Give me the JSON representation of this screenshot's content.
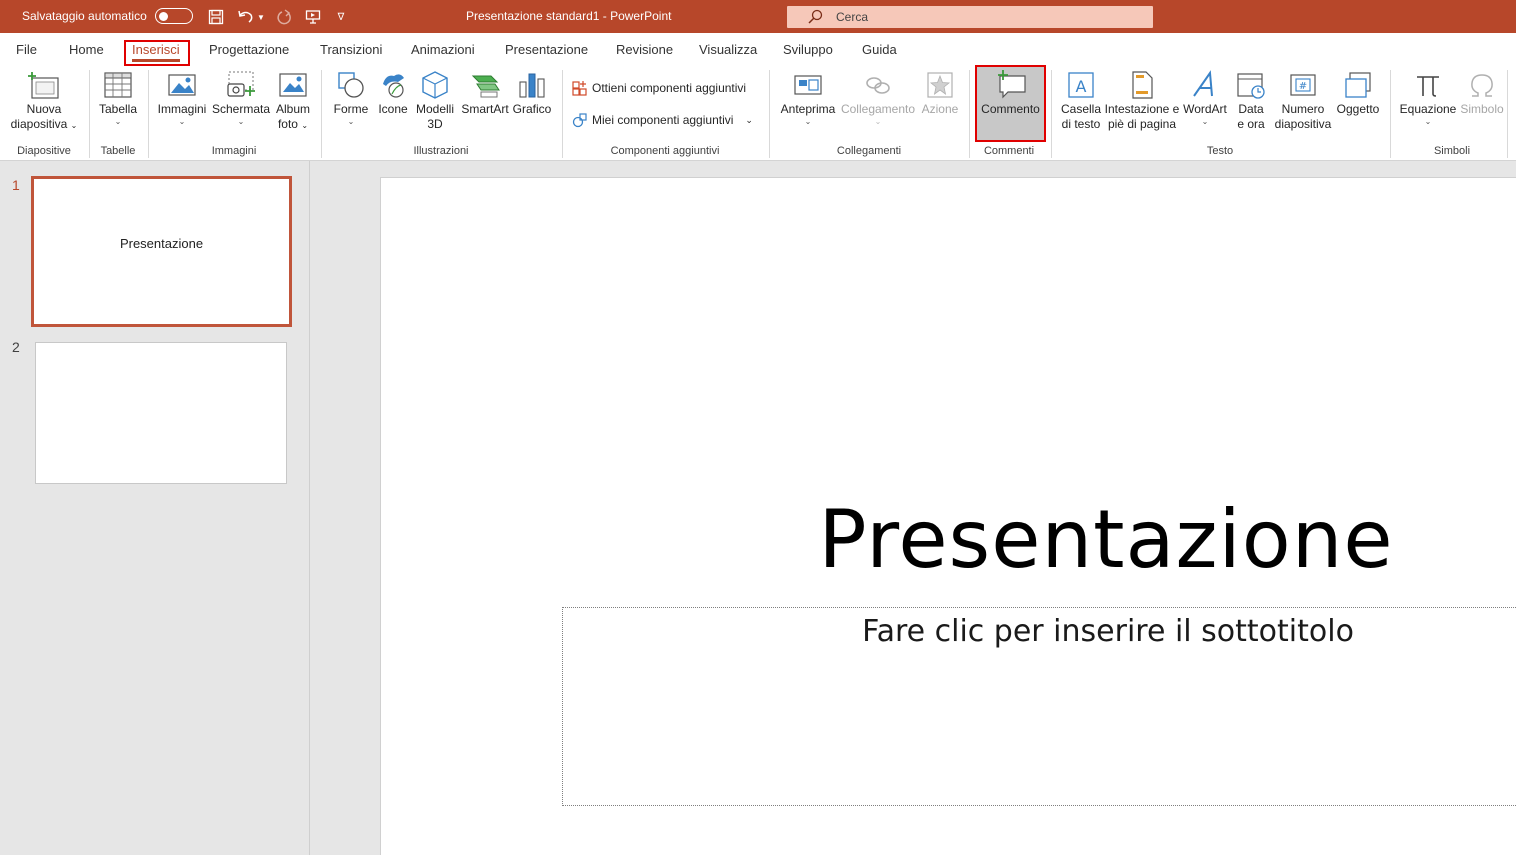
{
  "titlebar": {
    "autosave_label": "Salvataggio automatico",
    "doc_title": "Presentazione standard1  -  PowerPoint",
    "search_placeholder": "Cerca"
  },
  "tabs": [
    {
      "label": "File"
    },
    {
      "label": "Home"
    },
    {
      "label": "Inserisci",
      "active": true
    },
    {
      "label": "Progettazione"
    },
    {
      "label": "Transizioni"
    },
    {
      "label": "Animazioni"
    },
    {
      "label": "Presentazione"
    },
    {
      "label": "Revisione"
    },
    {
      "label": "Visualizza"
    },
    {
      "label": "Sviluppo"
    },
    {
      "label": "Guida"
    }
  ],
  "ribbon": {
    "groups": {
      "diapositive": "Diapositive",
      "tabelle": "Tabelle",
      "immagini": "Immagini",
      "illustrazioni": "Illustrazioni",
      "componenti": "Componenti aggiuntivi",
      "collegamenti": "Collegamenti",
      "commenti": "Commenti",
      "testo": "Testo",
      "simboli": "Simboli"
    },
    "buttons": {
      "nuova_1": "Nuova",
      "nuova_2": "diapositiva",
      "tabella": "Tabella",
      "immagini": "Immagini",
      "schermata": "Schermata",
      "album_1": "Album",
      "album_2": "foto",
      "forme": "Forme",
      "icone": "Icone",
      "modelli_1": "Modelli",
      "modelli_2": "3D",
      "smartart": "SmartArt",
      "grafico": "Grafico",
      "ottieni": "Ottieni componenti aggiuntivi",
      "miei": "Miei componenti aggiuntivi",
      "anteprima": "Anteprima",
      "collegamento": "Collegamento",
      "azione": "Azione",
      "commento": "Commento",
      "casella_1": "Casella",
      "casella_2": "di testo",
      "intestazione_1": "Intestazione e",
      "intestazione_2": "piè di pagina",
      "wordart": "WordArt",
      "data_1": "Data",
      "data_2": "e ora",
      "numero_1": "Numero",
      "numero_2": "diapositiva",
      "oggetto": "Oggetto",
      "equazione": "Equazione",
      "simbolo": "Simbolo"
    }
  },
  "thumbnails": [
    {
      "number": "1",
      "text": "Presentazione",
      "selected": true
    },
    {
      "number": "2",
      "text": "",
      "selected": false
    }
  ],
  "slide": {
    "title": "Presentazione",
    "subtitle": "Fare clic per inserire il sottotitolo"
  },
  "colors": {
    "accent": "#b7472a",
    "highlight": "#e00000"
  }
}
